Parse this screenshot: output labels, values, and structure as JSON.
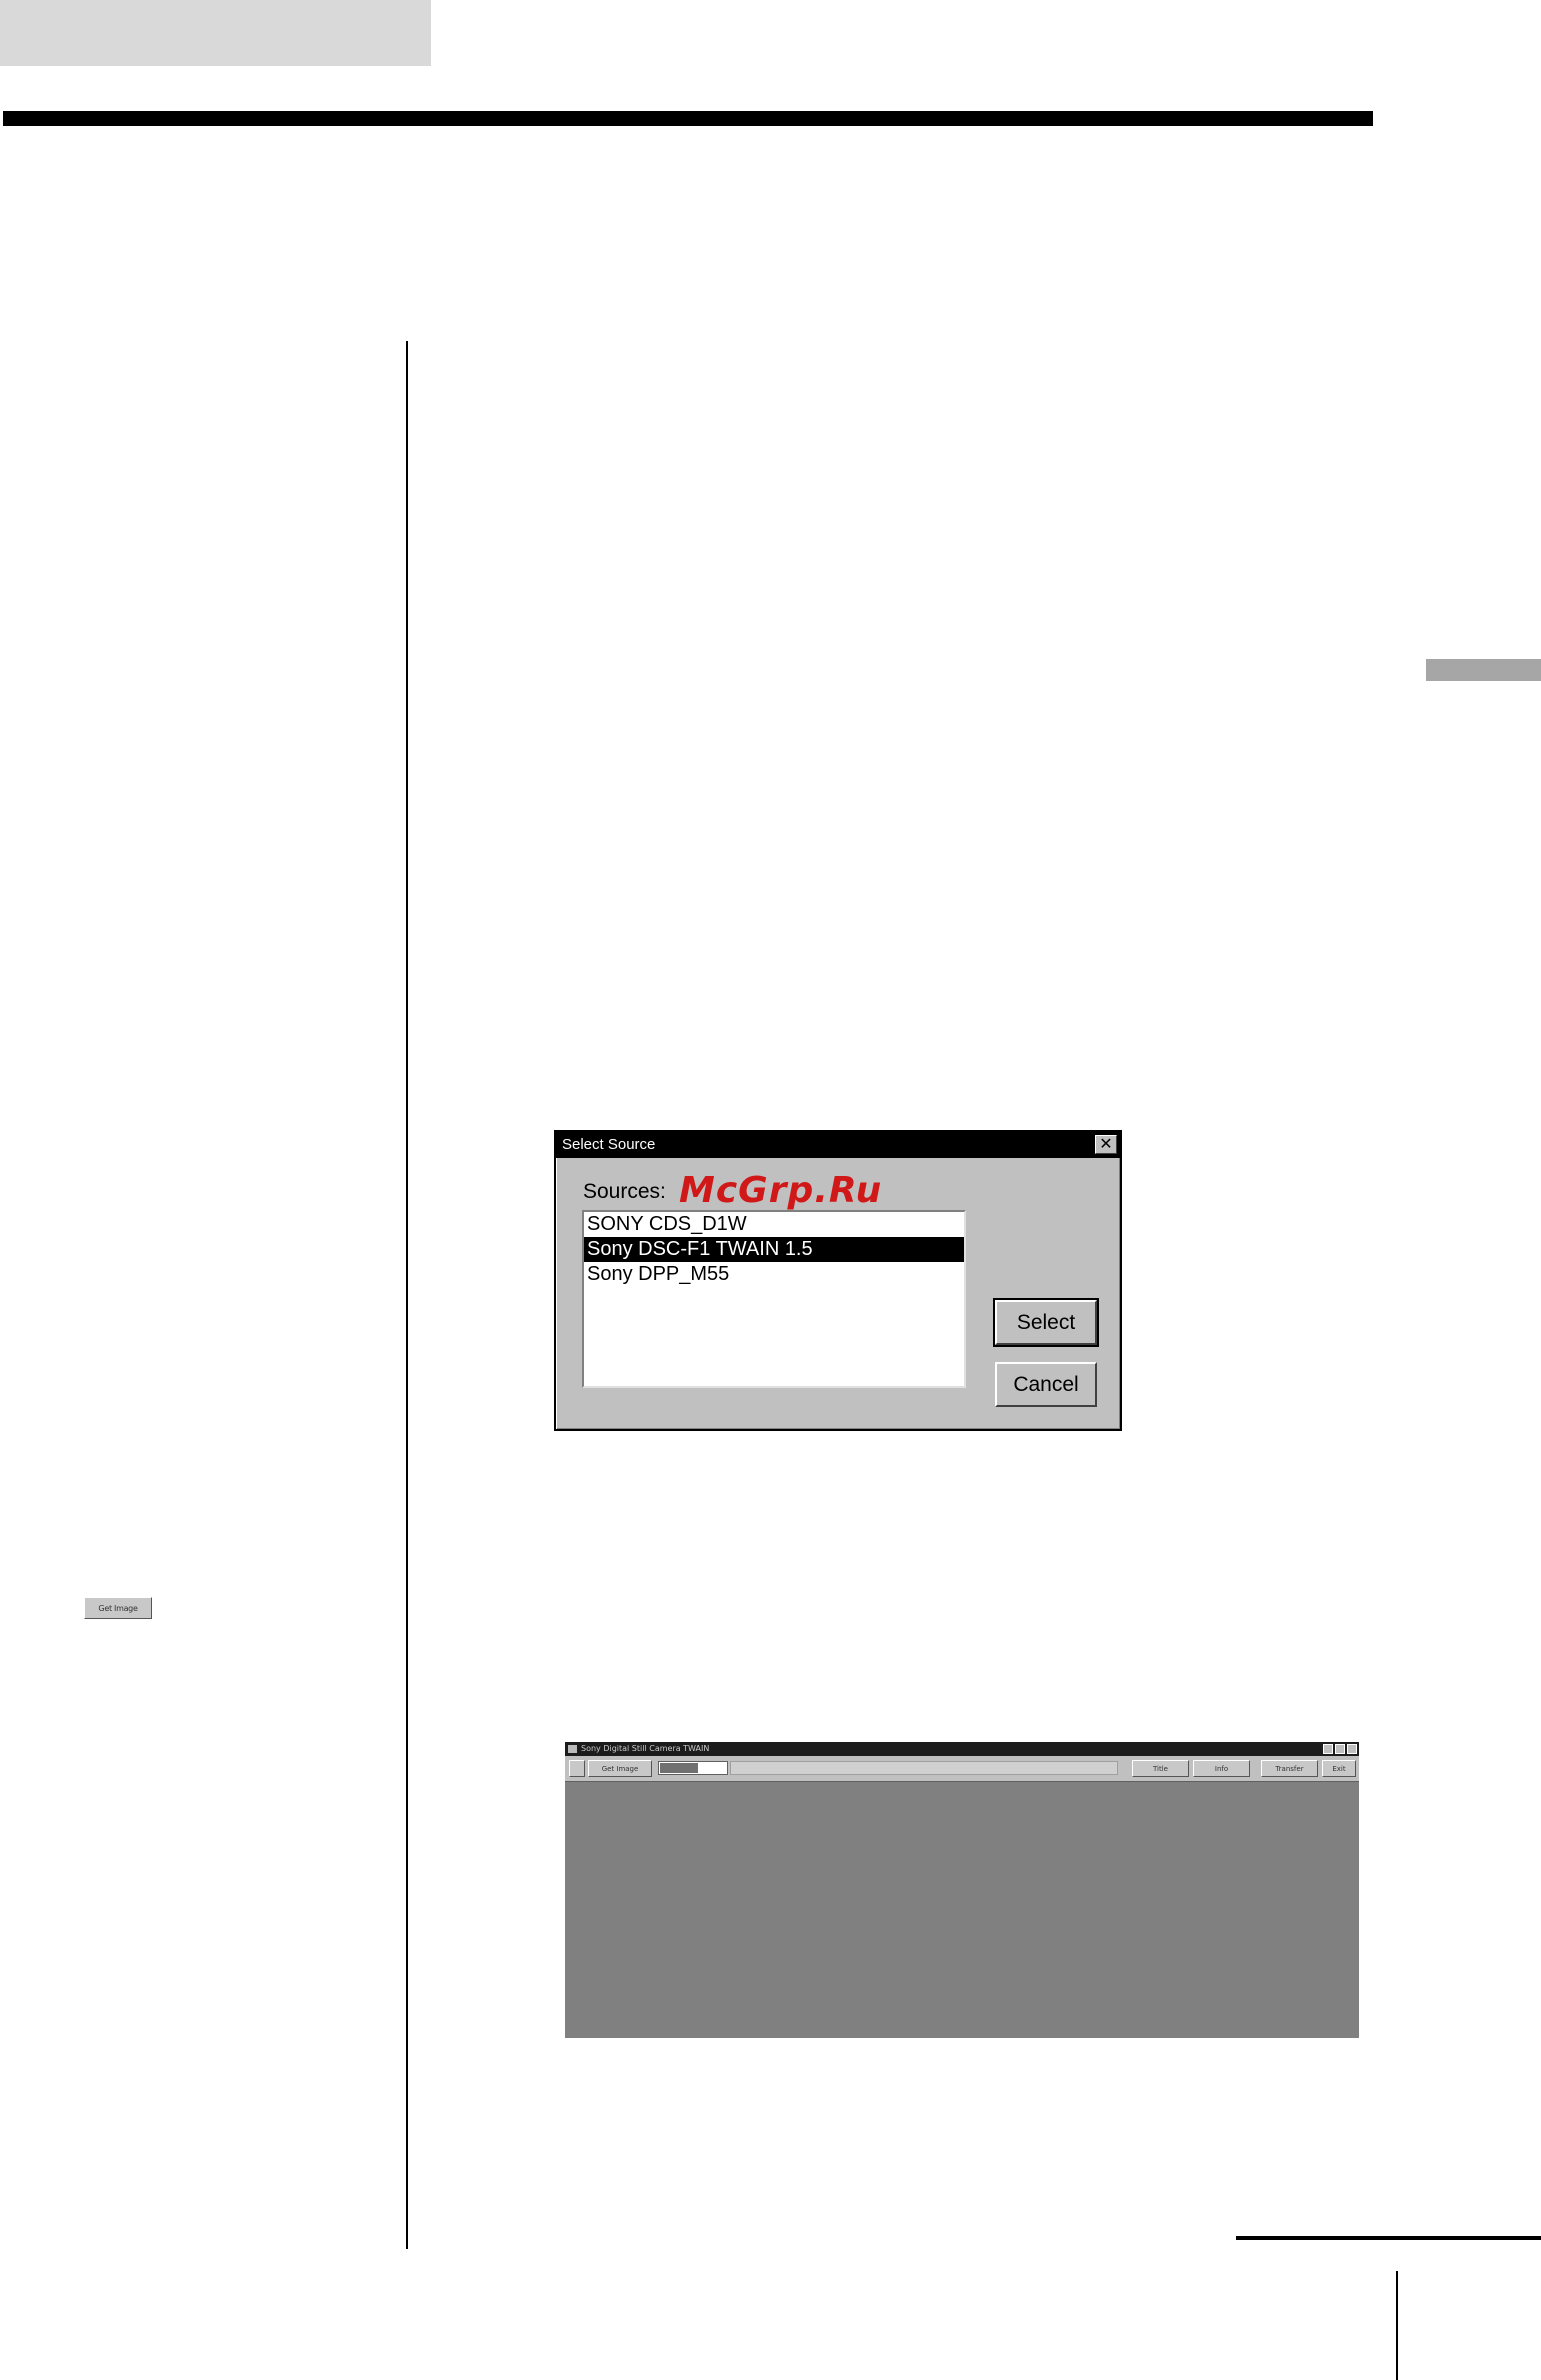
{
  "margin_icon": {
    "get_image_label": "Get Image"
  },
  "dialog": {
    "title": "Select Source",
    "close_glyph": "✕",
    "sources_label": "Sources:",
    "watermark": "McGrp.Ru",
    "sources": [
      {
        "label": "SONY CDS_D1W",
        "selected": false
      },
      {
        "label": "Sony DSC-F1 TWAIN 1.5",
        "selected": true
      },
      {
        "label": "Sony DPP_M55",
        "selected": false
      }
    ],
    "select_label": "Select",
    "cancel_label": "Cancel"
  },
  "app_window": {
    "title": "Sony Digital Still Camera TWAIN",
    "toolbar": {
      "get_image_label": "Get Image",
      "btn_a": "Title",
      "btn_b": "Info",
      "btn_c": "Transfer",
      "btn_d": "Exit"
    }
  }
}
